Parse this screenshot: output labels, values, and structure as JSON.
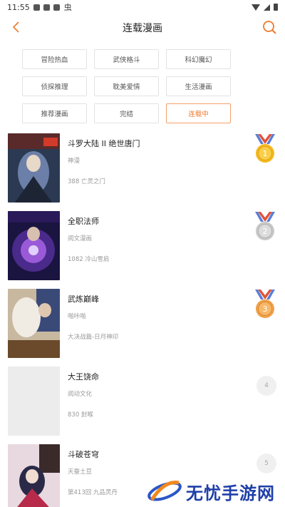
{
  "status_bar": {
    "time": "11:55",
    "bug_glyph": "虫"
  },
  "header": {
    "title": "连载漫画"
  },
  "categories": [
    {
      "label": "冒险热血",
      "active": false
    },
    {
      "label": "武侠格斗",
      "active": false
    },
    {
      "label": "科幻魔幻",
      "active": false
    },
    {
      "label": "侦探推理",
      "active": false
    },
    {
      "label": "耽美爱情",
      "active": false
    },
    {
      "label": "生活漫画",
      "active": false
    },
    {
      "label": "推荐漫画",
      "active": false
    },
    {
      "label": "完结",
      "active": false
    },
    {
      "label": "连载中",
      "active": true
    }
  ],
  "comics": [
    {
      "title": "斗罗大陆 II 绝世唐门",
      "author": "神漫",
      "chapter": "388 亡灵之门",
      "rank": "1",
      "medal": "gold"
    },
    {
      "title": "全职法师",
      "author": "阅文漫画",
      "chapter": "1082 冷山雪肩",
      "rank": "2",
      "medal": "silver"
    },
    {
      "title": "武炼巅峰",
      "author": "啪咔啪",
      "chapter": "大决战篇-日月神印",
      "rank": "3",
      "medal": "bronze"
    },
    {
      "title": "大王饶命",
      "author": "阅动文化",
      "chapter": "830 封喉",
      "rank": "4",
      "medal": "none"
    },
    {
      "title": "斗破苍穹",
      "author": "天蚕土豆",
      "chapter": "第413回 九品灵丹",
      "rank": "5",
      "medal": "none"
    }
  ],
  "watermark": {
    "text": "无忧手游网"
  },
  "colors": {
    "accent": "#ee7a2e",
    "gold": "#f5b81f",
    "silver": "#c8c8c8",
    "bronze": "#f0a04a",
    "ribbon": "#e0533a"
  }
}
